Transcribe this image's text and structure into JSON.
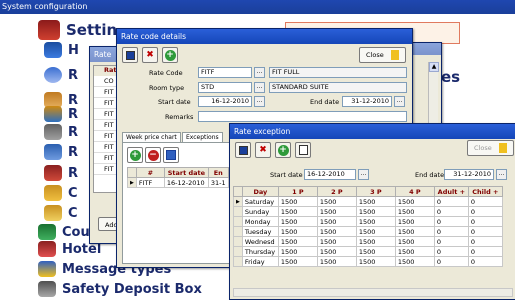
{
  "window": {
    "title": "System configuration"
  },
  "menu": {
    "items": [
      {
        "label": "Settin",
        "icon": "settings-icon"
      },
      {
        "label": "H",
        "icon": "hotel-icon"
      },
      {
        "label": "R",
        "icon": "rate-icon"
      },
      {
        "label": "R",
        "icon": "room-icon"
      },
      {
        "label": "R",
        "icon": "reservation-icon"
      },
      {
        "label": "R",
        "icon": "report-icon"
      },
      {
        "label": "R",
        "icon": "rates-icon"
      },
      {
        "label": "R",
        "icon": "register-icon"
      },
      {
        "label": "C",
        "icon": "company-icon"
      },
      {
        "label": "C",
        "icon": "currency-icon"
      },
      {
        "label": "Coun",
        "icon": "country-icon"
      },
      {
        "label": "Hotel",
        "icon": "hotel-service-icon"
      },
      {
        "label": "Message types",
        "icon": "message-icon"
      },
      {
        "label": "Safety Deposit Box",
        "icon": "safe-icon"
      }
    ],
    "right_fragment": "es"
  },
  "rate_list_window": {
    "title": "Rate",
    "header": "Rat",
    "rows": [
      "CO",
      "FIT",
      "FIT",
      "FIT",
      "FIT",
      "FIT",
      "FIT",
      "FIT",
      "FIT"
    ],
    "add_label": "Add"
  },
  "rate_details": {
    "title": "Rate code details",
    "close_label": "Close",
    "rate_code_label": "Rate Code",
    "rate_code": "FITF",
    "rate_code_name": "FIT FULL",
    "room_type_label": "Room type",
    "room_type": "STD",
    "room_type_name": "STANDARD SUITE",
    "start_date_label": "Start date",
    "start_date": "16-12-2010",
    "end_date_label": "End date",
    "end_date": "31-12-2010",
    "remarks_label": "Remarks",
    "tabs": [
      "Week price chart",
      "Exceptions"
    ],
    "grid_headers": [
      "#",
      "Start date",
      "En"
    ],
    "grid_rows": [
      {
        "code": "FITF",
        "start": "16-12-2010",
        "end": "31-1"
      }
    ]
  },
  "rate_exception": {
    "title": "Rate exception",
    "close_label": "Close",
    "start_date_label": "Start date",
    "start_date": "16-12-2010",
    "end_date_label": "End date",
    "end_date": "31-12-2010",
    "headers": [
      "Day",
      "1 P",
      "2 P",
      "3 P",
      "4 P",
      "Adult +",
      "Child +"
    ],
    "rows": [
      [
        "Saturday",
        "1500",
        "1500",
        "1500",
        "1500",
        "0",
        "0"
      ],
      [
        "Sunday",
        "1500",
        "1500",
        "1500",
        "1500",
        "0",
        "0"
      ],
      [
        "Monday",
        "1500",
        "1500",
        "1500",
        "1500",
        "0",
        "0"
      ],
      [
        "Tuesday",
        "1500",
        "1500",
        "1500",
        "1500",
        "0",
        "0"
      ],
      [
        "Wednesd",
        "1500",
        "1500",
        "1500",
        "1500",
        "0",
        "0"
      ],
      [
        "Thursday",
        "1500",
        "1500",
        "1500",
        "1500",
        "0",
        "0"
      ],
      [
        "Friday",
        "1500",
        "1500",
        "1500",
        "1500",
        "0",
        "0"
      ]
    ]
  },
  "colors": {
    "title_bar": "#1f47b0",
    "window_title": "#2a5fd8",
    "menu_text": "#1b2a6c",
    "grid_header_text": "#800000"
  }
}
